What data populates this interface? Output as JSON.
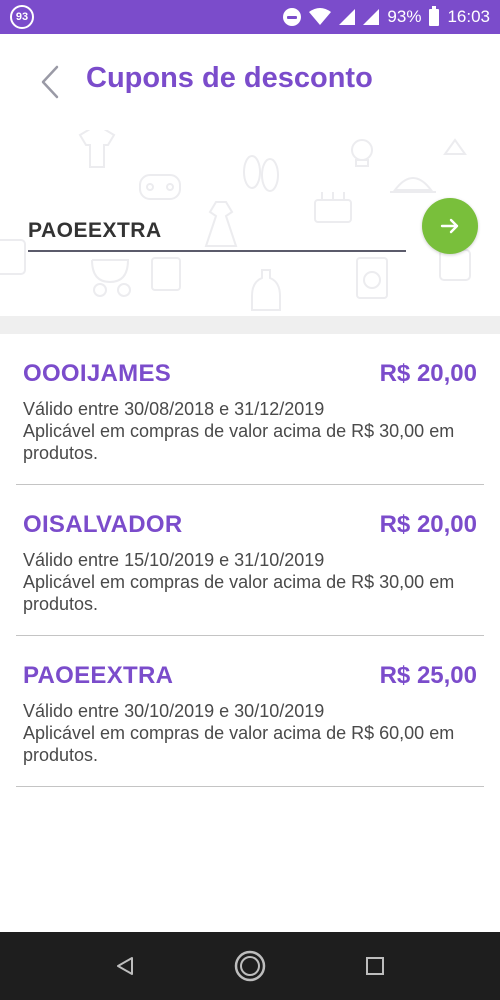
{
  "status_bar": {
    "notification_count": "93",
    "battery": "93%",
    "time": "16:03"
  },
  "header": {
    "title": "Cupons de desconto"
  },
  "search": {
    "value": "PAOEEXTRA"
  },
  "coupons": [
    {
      "code": "OOOIJAMES",
      "value": "R$ 20,00",
      "validity": "Válido entre 30/08/2018 e 31/12/2019",
      "condition": "Aplicável em compras de valor acima de R$ 30,00 em produtos."
    },
    {
      "code": "OISALVADOR",
      "value": "R$ 20,00",
      "validity": "Válido entre 15/10/2019 e 31/10/2019",
      "condition": "Aplicável em compras de valor acima de R$ 30,00 em produtos."
    },
    {
      "code": "PAOEEXTRA",
      "value": "R$ 25,00",
      "validity": "Válido entre 30/10/2019 e 30/10/2019",
      "condition": "Aplicável em compras de valor acima de R$ 60,00 em produtos."
    }
  ],
  "colors": {
    "brand": "#7b4ccb",
    "accent_green": "#79bf3b",
    "nav_bg": "#1e1e1e"
  },
  "icons": {
    "back": "chevron-left-icon",
    "submit": "arrow-right-icon",
    "nav_back": "triangle-back-icon",
    "nav_home": "circle-home-icon",
    "nav_recents": "square-recents-icon"
  }
}
